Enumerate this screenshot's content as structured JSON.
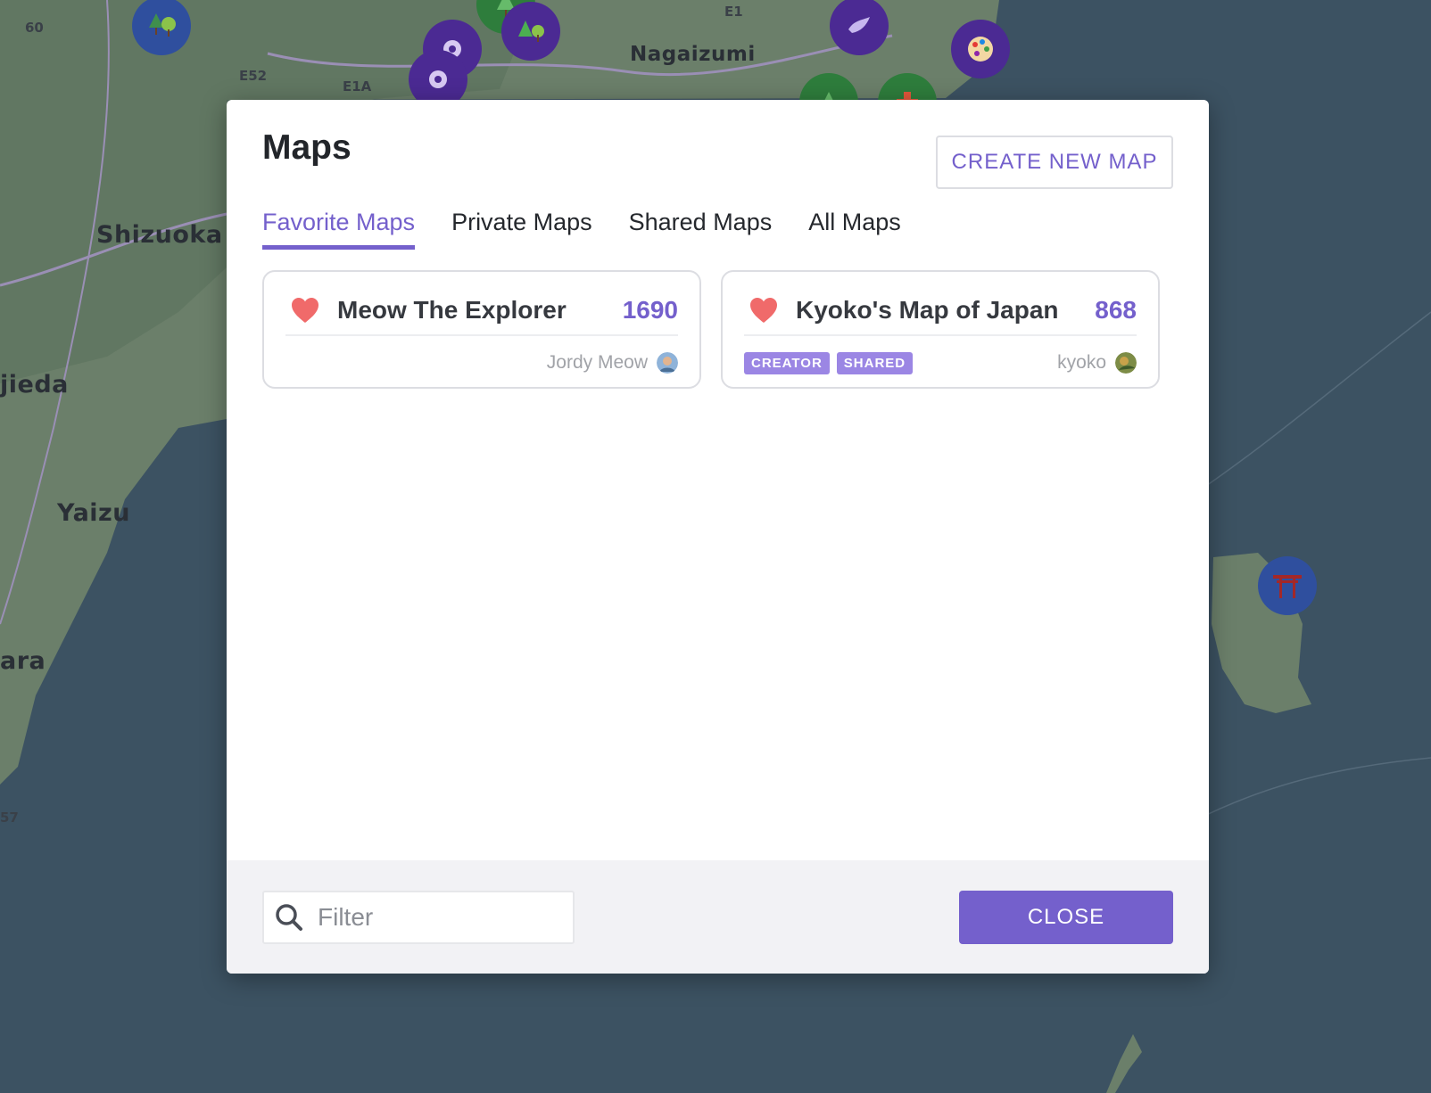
{
  "map": {
    "places": [
      "Nagaizumi",
      "Shizuoka",
      "jieda",
      "Yaizu",
      "ara"
    ],
    "roads": [
      "60",
      "E52",
      "E1A",
      "E1",
      "57"
    ],
    "pois": [
      {
        "icon": "tree-icon",
        "color": "#2f4f9e"
      },
      {
        "icon": "tree-icon",
        "color": "#2e7d3c"
      },
      {
        "icon": "tree-icon",
        "color": "#4b2a93"
      },
      {
        "icon": "flower-icon",
        "color": "#4b2a93"
      },
      {
        "icon": "flower-icon",
        "color": "#4b2a93"
      },
      {
        "icon": "bird-icon",
        "color": "#4b2a93"
      },
      {
        "icon": "palette-icon",
        "color": "#4b2a93"
      },
      {
        "icon": "tree-icon",
        "color": "#2e7d3c"
      },
      {
        "icon": "cross-icon",
        "color": "#2e7d3c"
      },
      {
        "icon": "torii-icon",
        "color": "#2f4f9e"
      }
    ]
  },
  "modal": {
    "title": "Maps",
    "create_button": "CREATE NEW MAP",
    "tabs": [
      {
        "label": "Favorite Maps",
        "active": true
      },
      {
        "label": "Private Maps",
        "active": false
      },
      {
        "label": "Shared Maps",
        "active": false
      },
      {
        "label": "All Maps",
        "active": false
      }
    ],
    "cards": [
      {
        "title": "Meow The Explorer",
        "count": "1690",
        "badges": [],
        "owner": "Jordy Meow",
        "icon": "heart-icon"
      },
      {
        "title": "Kyoko's Map of Japan",
        "count": "868",
        "badges": [
          "CREATOR",
          "SHARED"
        ],
        "owner": "kyoko",
        "icon": "heart-icon"
      }
    ],
    "footer": {
      "filter_placeholder": "Filter",
      "filter_value": "",
      "close_button": "CLOSE"
    }
  },
  "colors": {
    "accent": "#7460cc",
    "heart": "#f06a6a",
    "badge": "#9b86e4",
    "footer_bg": "#f2f2f5",
    "sea": "#3c5262",
    "land": "#6b7f6a"
  }
}
